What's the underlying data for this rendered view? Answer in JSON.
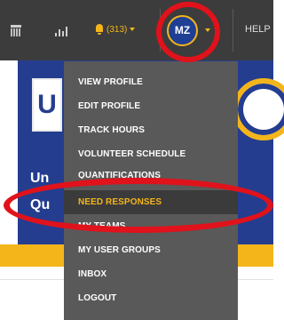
{
  "colors": {
    "topbar": "#3c3c3c",
    "accent": "#f3b51a",
    "menu_bg": "#595959",
    "menu_active_bg": "#3b3b3b",
    "banner": "#243d8f",
    "annotation": "#e0121b"
  },
  "nav": {
    "icons": [
      "calendar-icon",
      "chart-icon",
      "bell-icon",
      "chevron-down-icon"
    ],
    "notifications_label": "(313)",
    "avatar_initials": "MZ",
    "help_label": "HELP"
  },
  "banner": {
    "logo_letter": "U",
    "line1": "Un",
    "line2": "Qu"
  },
  "menu": {
    "items": [
      {
        "label": "VIEW PROFILE"
      },
      {
        "label": "EDIT PROFILE"
      },
      {
        "label": "TRACK HOURS"
      },
      {
        "label": "VOLUNTEER SCHEDULE"
      },
      {
        "label": "QUANTIFICATIONS"
      },
      {
        "label": "NEED RESPONSES",
        "active": true
      },
      {
        "label": "MY TEAMS"
      },
      {
        "label": "MY USER GROUPS"
      },
      {
        "label": "INBOX"
      },
      {
        "label": "LOGOUT"
      }
    ]
  }
}
